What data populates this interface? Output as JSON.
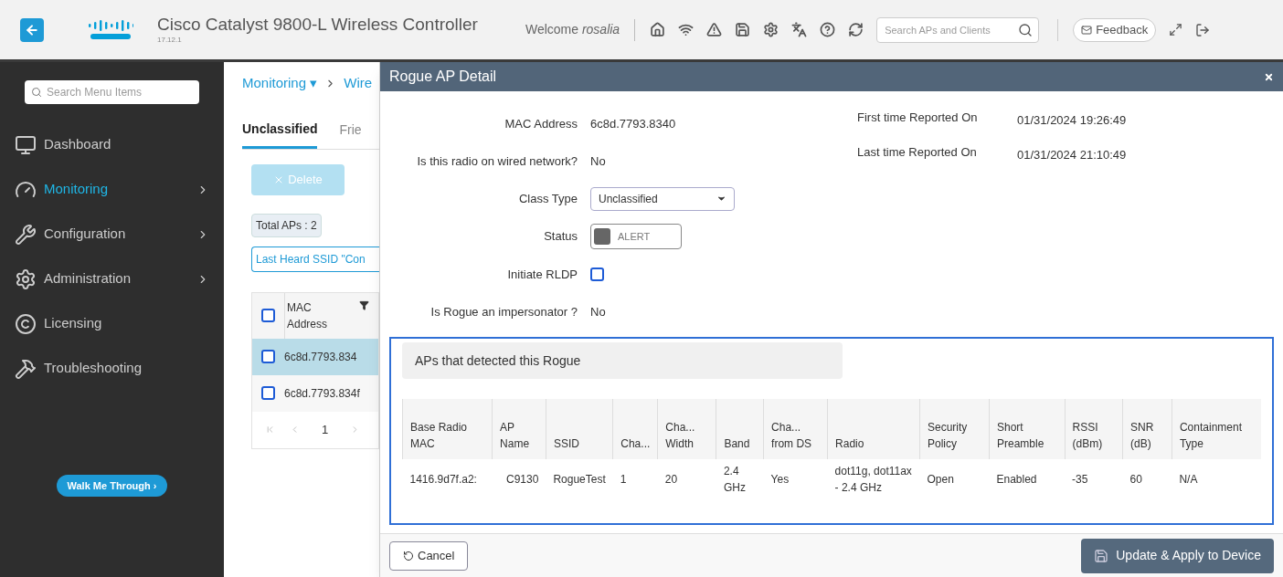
{
  "header": {
    "title": "Cisco Catalyst 9800-L Wireless Controller",
    "version": "17.12.1",
    "welcome": "Welcome",
    "user": "rosalia",
    "search": {
      "placeholder": "Search APs and Clients"
    },
    "feedback": "Feedback"
  },
  "sidebar": {
    "search": {
      "placeholder": "Search Menu Items"
    },
    "items": [
      {
        "label": "Dashboard",
        "selected": false,
        "expandable": false
      },
      {
        "label": "Monitoring",
        "selected": true,
        "expandable": true
      },
      {
        "label": "Configuration",
        "selected": false,
        "expandable": true
      },
      {
        "label": "Administration",
        "selected": false,
        "expandable": true
      },
      {
        "label": "Licensing",
        "selected": false,
        "expandable": false
      },
      {
        "label": "Troubleshooting",
        "selected": false,
        "expandable": false
      }
    ],
    "walk_me": "Walk Me Through ›"
  },
  "main": {
    "breadcrumb": [
      "Monitoring",
      "Wire"
    ],
    "breadcrumb_caret": "▾",
    "tabs": [
      {
        "label": "Unclassified",
        "selected": true
      },
      {
        "label": "Frie",
        "selected": false
      }
    ],
    "delete_button": {
      "label": "Delete",
      "disabled": true
    },
    "total": "Total APs : 2",
    "filter": "Last Heard SSID \"Con",
    "table": {
      "all_checked": false,
      "columns": [
        "MAC Address"
      ],
      "rows": [
        {
          "mac": "6c8d.7793.834",
          "selected": true,
          "checked": false
        },
        {
          "mac": "6c8d.7793.834f",
          "selected": false,
          "checked": false
        }
      ]
    },
    "page": "1"
  },
  "modal": {
    "title": "Rogue AP Detail",
    "fields": [
      {
        "kind": "text",
        "label": "MAC Address",
        "value": "6c8d.7793.8340"
      },
      {
        "kind": "text",
        "label": "Is this radio on wired network?",
        "value": "No"
      },
      {
        "kind": "select",
        "label": "Class Type",
        "value": "Unclassified"
      },
      {
        "kind": "status",
        "label": "Status",
        "value": "ALERT"
      },
      {
        "kind": "checkbox",
        "label": "Initiate RLDP",
        "checked": false
      },
      {
        "kind": "text",
        "label": "Is Rogue an impersonator ?",
        "value": "No"
      }
    ],
    "reports": [
      {
        "label": "First time Reported On",
        "value": "01/31/2024 19:26:49"
      },
      {
        "label": "Last time Reported On",
        "value": "01/31/2024 21:10:49"
      }
    ],
    "detected": {
      "title": "APs that detected this Rogue",
      "columns": [
        "Base Radio MAC",
        "AP Name",
        "SSID",
        "Cha...",
        "Cha... Width",
        "Band",
        "Cha... from DS",
        "Radio",
        "Security Policy",
        "Short Preamble",
        "RSSI (dBm)",
        "SNR (dB)",
        "Containment Type"
      ],
      "rows": [
        [
          "1416.9d7f.a2:",
          "C9130",
          "RogueTest",
          "1",
          "20",
          "2.4 GHz",
          "Yes",
          "dot11g, dot11ax - 2.4 GHz",
          "Open",
          "Enabled",
          "-35",
          "60",
          "N/A"
        ]
      ]
    },
    "cancel": "Cancel",
    "apply": "Update & Apply to Device"
  }
}
